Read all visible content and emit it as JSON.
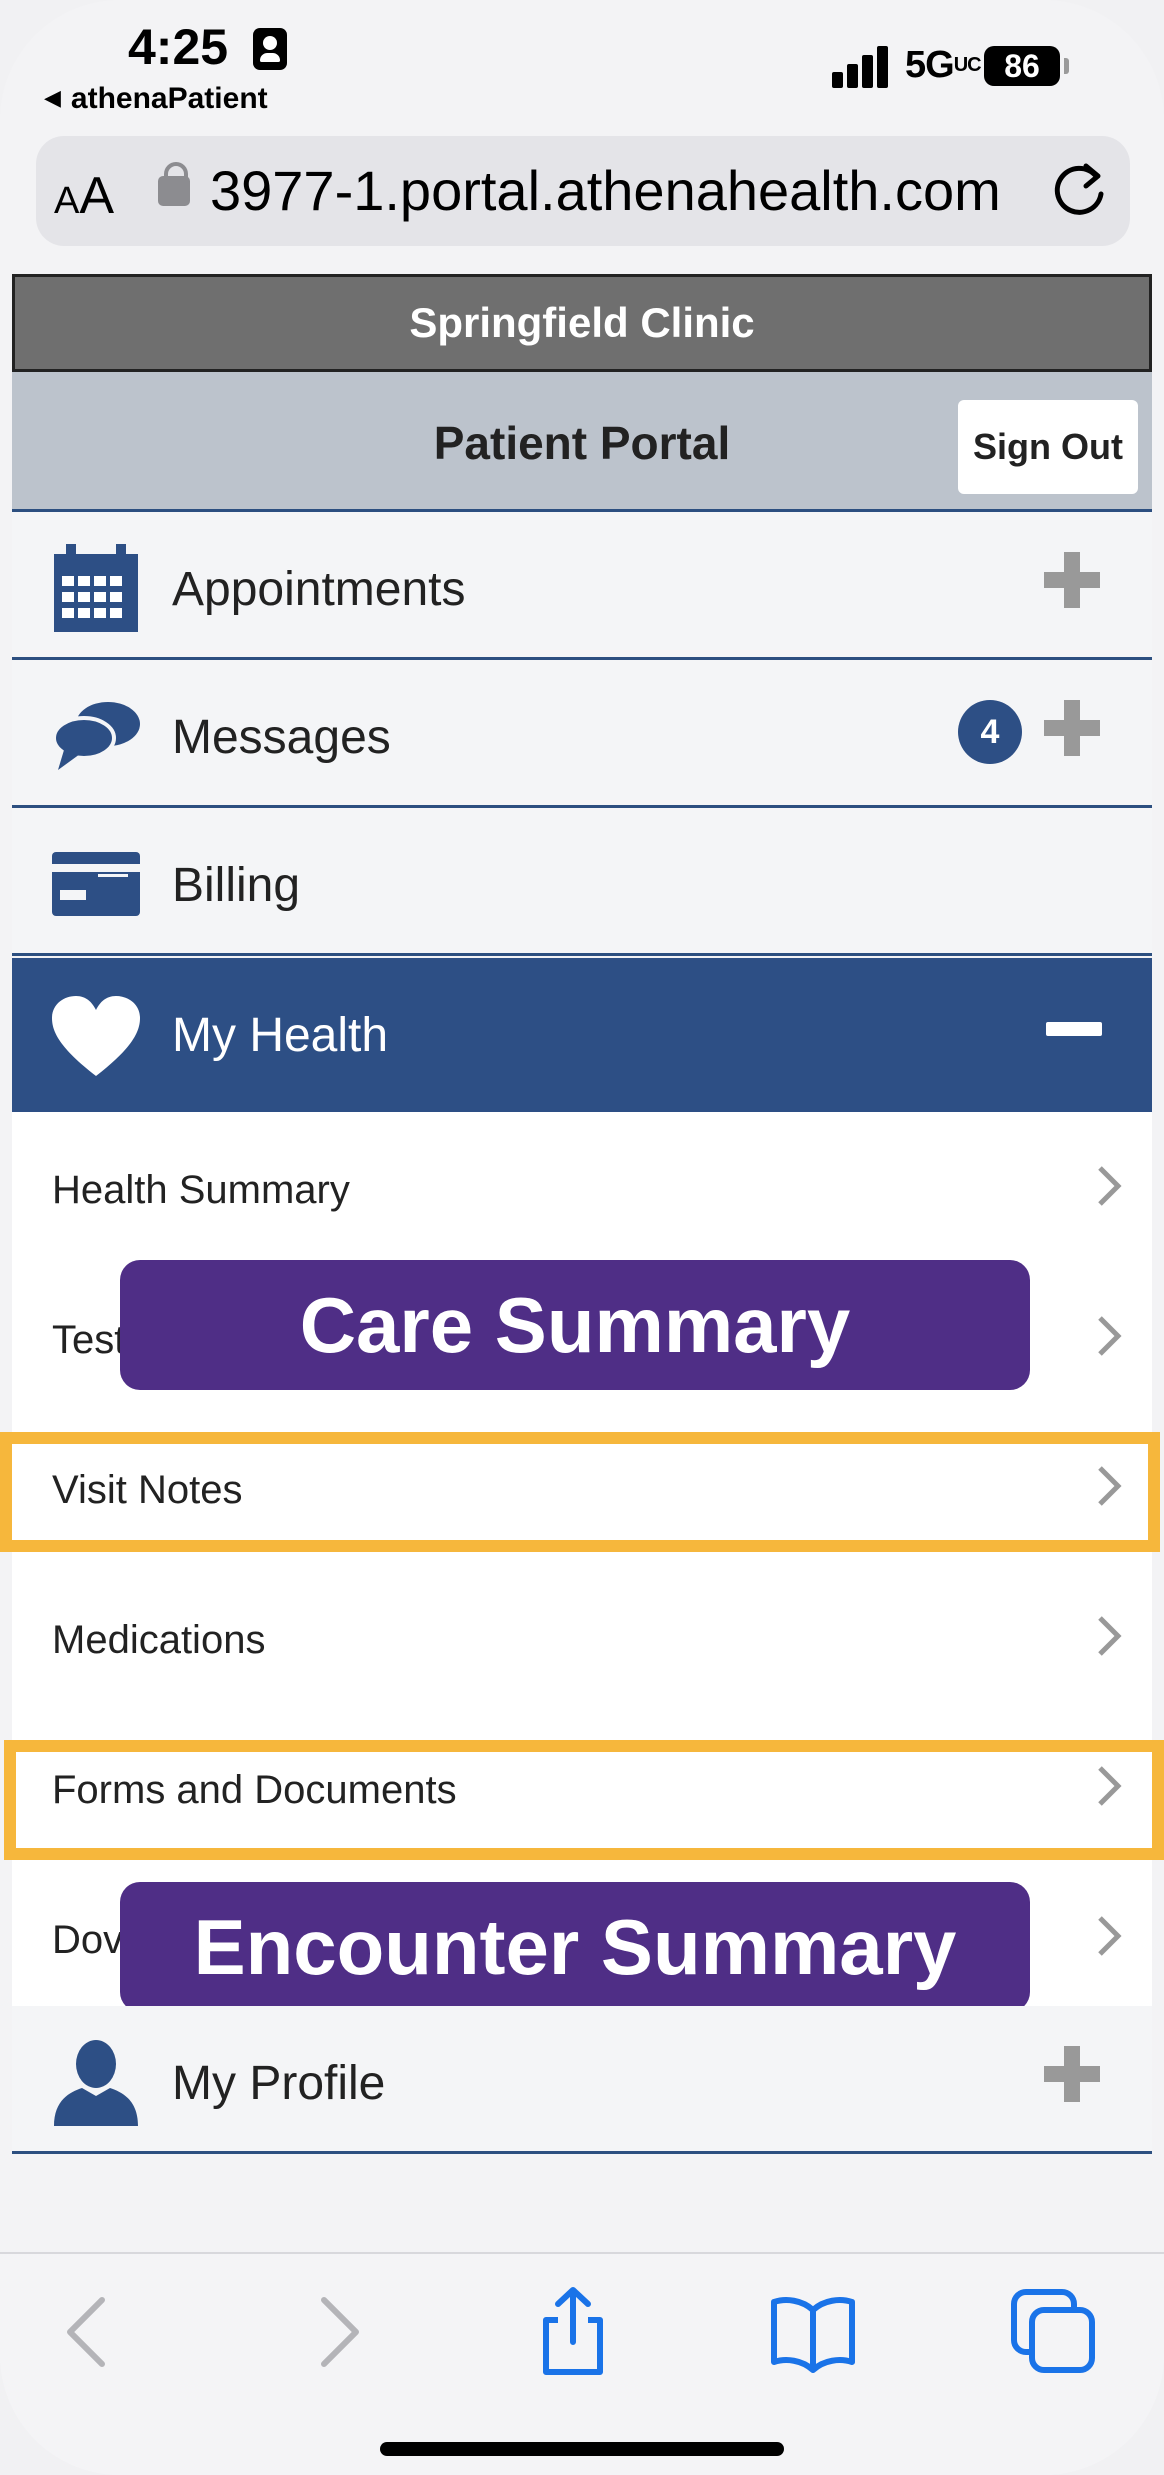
{
  "status_bar": {
    "time": "4:25",
    "back_app": "athenaPatient",
    "network": "5G",
    "network_suffix": "UC",
    "battery": "86"
  },
  "browser": {
    "url": "3977-1.portal.athenahealth.com",
    "text_size_label": "AA"
  },
  "header": {
    "clinic_name": "Springfield Clinic",
    "portal_title": "Patient Portal",
    "sign_out": "Sign Out"
  },
  "nav": {
    "appointments": "Appointments",
    "messages": "Messages",
    "messages_count": "4",
    "billing": "Billing",
    "my_health": "My Health",
    "my_profile": "My Profile"
  },
  "my_health_items": [
    {
      "label": "Health Summary"
    },
    {
      "label": "Test"
    },
    {
      "label": "Visit Notes"
    },
    {
      "label": "Medications"
    },
    {
      "label": "Forms and Documents"
    },
    {
      "label": "Dov"
    }
  ],
  "callouts": {
    "care_summary": "Care Summary",
    "encounter_summary": "Encounter Summary"
  },
  "colors": {
    "nav_accent": "#2d4f85",
    "highlight": "#f6b73c",
    "callout": "#4f2e86",
    "ios_blue": "#1a73e8"
  },
  "icons": [
    "calendar-icon",
    "speech-bubbles-icon",
    "credit-card-icon",
    "heart-icon",
    "person-icon",
    "share-icon",
    "bookmarks-icon",
    "tabs-icon"
  ]
}
